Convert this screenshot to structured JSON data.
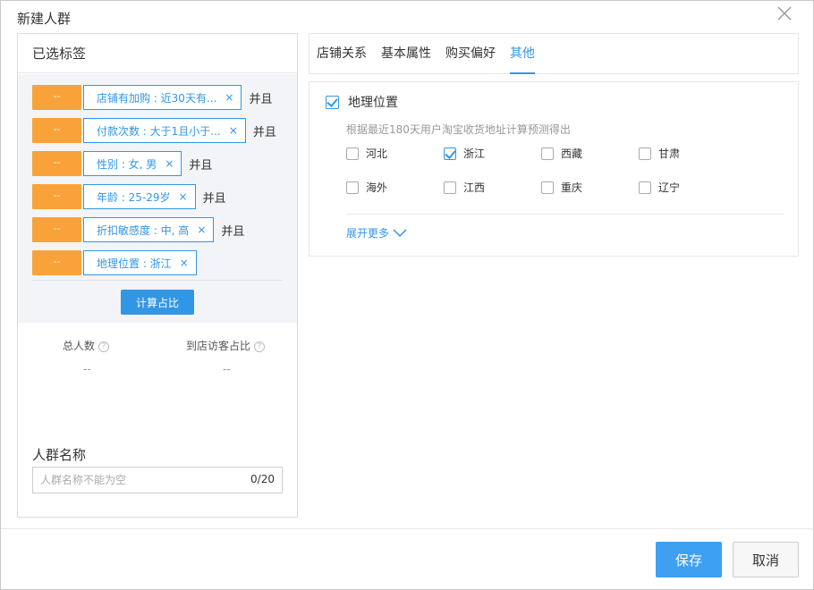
{
  "dialog": {
    "title": "新建人群"
  },
  "left": {
    "heading": "已选标签",
    "tags": [
      {
        "handle": "--",
        "label": "店铺有加购 : 近30天有...",
        "remove": "×",
        "conj": "并且"
      },
      {
        "handle": "--",
        "label": "付款次数 : 大于1且小于...",
        "remove": "×",
        "conj": "并且"
      },
      {
        "handle": "--",
        "label": "性别 : 女, 男",
        "remove": "×",
        "conj": "并且"
      },
      {
        "handle": "--",
        "label": "年龄 : 25-29岁",
        "remove": "×",
        "conj": "并且"
      },
      {
        "handle": "--",
        "label": "折扣敏感度 : 中, 高",
        "remove": "×",
        "conj": "并且"
      },
      {
        "handle": "--",
        "label": "地理位置 : 浙江",
        "remove": "×",
        "conj": ""
      }
    ],
    "calc_button": "计算占比",
    "stats": [
      {
        "label": "总人数",
        "help": "?",
        "value": "--"
      },
      {
        "label": "到店访客占比",
        "help": "?",
        "value": "--"
      }
    ],
    "name_label": "人群名称",
    "name_placeholder": "人群名称不能为空",
    "name_counter": "0/20"
  },
  "tabs": [
    {
      "label": "店铺关系",
      "active": false
    },
    {
      "label": "基本属性",
      "active": false
    },
    {
      "label": "购买偏好",
      "active": false
    },
    {
      "label": "其他",
      "active": true
    }
  ],
  "geo": {
    "title": "地理位置",
    "checked": true,
    "description": "根据最近180天用户淘宝收货地址计算预测得出",
    "provinces": [
      {
        "name": "河北",
        "checked": false
      },
      {
        "name": "浙江",
        "checked": true
      },
      {
        "name": "西藏",
        "checked": false
      },
      {
        "name": "甘肃",
        "checked": false
      },
      {
        "name": "海外",
        "checked": false
      },
      {
        "name": "江西",
        "checked": false
      },
      {
        "name": "重庆",
        "checked": false
      },
      {
        "name": "辽宁",
        "checked": false
      }
    ],
    "expand_label": "展开更多"
  },
  "footer": {
    "save": "保存",
    "cancel": "取消"
  },
  "colors": {
    "accent": "#3296e6",
    "tag_handle": "#f9a23a"
  }
}
